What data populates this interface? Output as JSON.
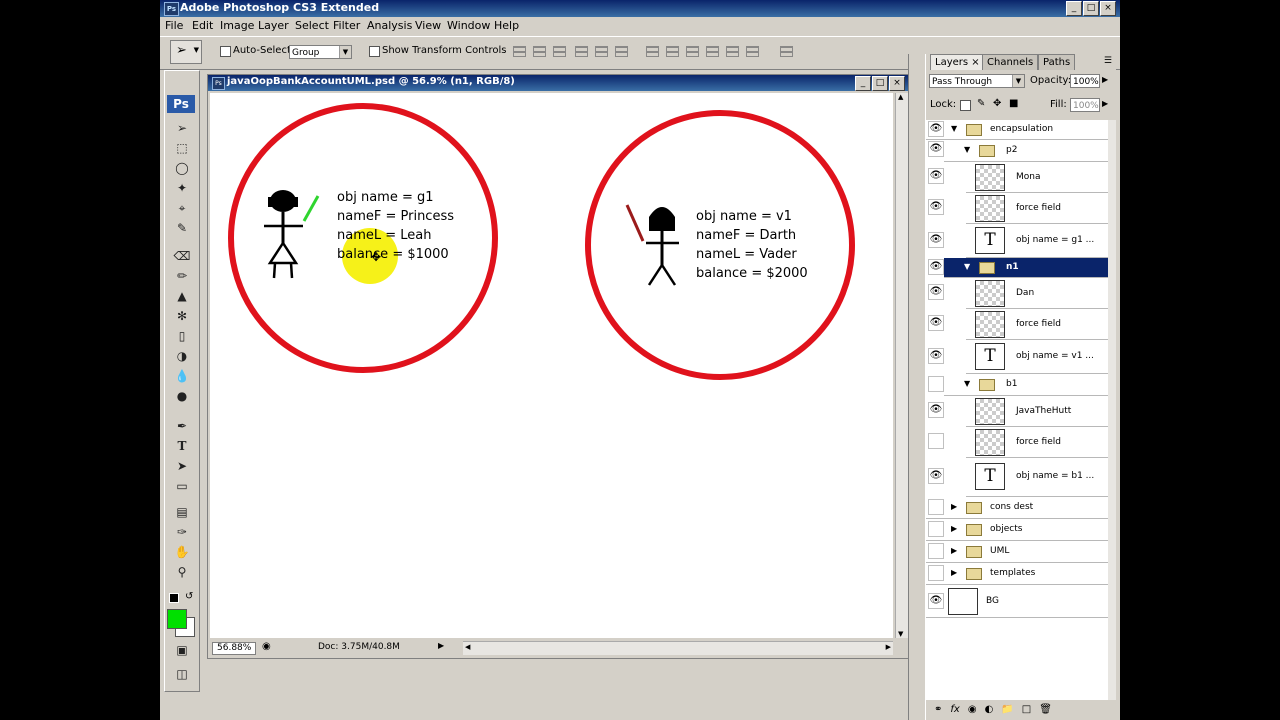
{
  "app": {
    "title": "Adobe Photoshop CS3 Extended",
    "ps_badge": "Ps",
    "win_buttons": [
      "_",
      "□",
      "×"
    ]
  },
  "menu": [
    "File",
    "Edit",
    "Image",
    "Layer",
    "Select",
    "Filter",
    "Analysis",
    "View",
    "Window",
    "Help"
  ],
  "options": {
    "auto_select_label": "Auto-Select:",
    "auto_select_value": "Group",
    "show_transform_label": "Show Transform Controls"
  },
  "document": {
    "title": "javaOopBankAccountUML.psd @ 56.9% (n1, RGB/8)",
    "zoom": "56.88%",
    "doc_info": "Doc: 3.75M/40.8M",
    "left_object": [
      "obj name = g1",
      "nameF = Princess",
      "nameL = Leah",
      "balance = $1000"
    ],
    "right_object": [
      "obj name = v1",
      "nameF = Darth",
      "nameL = Vader",
      "balance = $2000"
    ]
  },
  "layers_panel": {
    "tabs": [
      "Layers ×",
      "Channels",
      "Paths"
    ],
    "blend_mode": "Pass Through",
    "opacity_label": "Opacity:",
    "opacity_value": "100%",
    "lock_label": "Lock:",
    "fill_label": "Fill:",
    "fill_value": "100%",
    "layers": [
      {
        "name": "encapsulation",
        "kind": "group",
        "depth": 0,
        "visible": true,
        "expanded": true,
        "selected": false
      },
      {
        "name": "p2",
        "kind": "group",
        "depth": 1,
        "visible": true,
        "expanded": true,
        "selected": false
      },
      {
        "name": "Mona",
        "kind": "pixel",
        "depth": 2,
        "visible": true,
        "selected": false
      },
      {
        "name": "force field",
        "kind": "pixel",
        "depth": 2,
        "visible": true,
        "selected": false
      },
      {
        "name": "obj name = g1 ...",
        "kind": "text",
        "depth": 2,
        "visible": true,
        "selected": false
      },
      {
        "name": "n1",
        "kind": "group",
        "depth": 1,
        "visible": true,
        "expanded": true,
        "selected": true
      },
      {
        "name": "Dan",
        "kind": "pixel",
        "depth": 2,
        "visible": true,
        "selected": false
      },
      {
        "name": "force field",
        "kind": "pixel",
        "depth": 2,
        "visible": true,
        "selected": false
      },
      {
        "name": "obj name = v1 ...",
        "kind": "text",
        "depth": 2,
        "visible": true,
        "selected": false
      },
      {
        "name": "b1",
        "kind": "group",
        "depth": 1,
        "visible": false,
        "expanded": true,
        "selected": false
      },
      {
        "name": "JavaTheHutt",
        "kind": "pixel",
        "depth": 2,
        "visible": true,
        "selected": false
      },
      {
        "name": "force field",
        "kind": "pixel",
        "depth": 2,
        "visible": false,
        "selected": false
      },
      {
        "name": "obj name = b1 ...",
        "kind": "text",
        "depth": 2,
        "visible": true,
        "selected": false
      },
      {
        "name": "cons dest",
        "kind": "group",
        "depth": 0,
        "visible": false,
        "expanded": false,
        "selected": false
      },
      {
        "name": "objects",
        "kind": "group",
        "depth": 0,
        "visible": false,
        "expanded": false,
        "selected": false
      },
      {
        "name": "UML",
        "kind": "group",
        "depth": 0,
        "visible": false,
        "expanded": false,
        "selected": false
      },
      {
        "name": "templates",
        "kind": "group",
        "depth": 0,
        "visible": false,
        "expanded": false,
        "selected": false
      },
      {
        "name": "BG",
        "kind": "background",
        "depth": 0,
        "visible": true,
        "selected": false
      }
    ],
    "bottom_icons": [
      "link-icon",
      "fx-icon",
      "mask-icon",
      "adjustment-icon",
      "new-group-icon",
      "new-layer-icon",
      "trash-icon"
    ]
  },
  "colors": {
    "title_bar": "#0a246a",
    "circle": "#e0121c",
    "lightsaber_green": "#2fd52f",
    "lightsaber_red": "#9b1b1b",
    "highlight": "#f5f000",
    "foreground": "#00e000",
    "selected_row": "#0a246a"
  }
}
